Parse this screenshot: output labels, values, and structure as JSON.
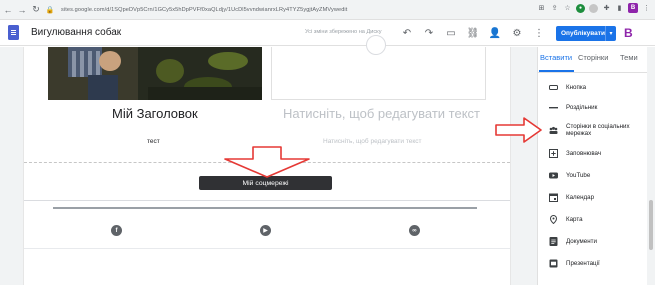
{
  "browser": {
    "url": "sites.google.com/d/1SQpeDVp5Crn/1GCy5x5hDpPVFf0xaQLdjy/1UcDl5vvndwianrxLRy4TYZ5ygjtAyZMVywedit"
  },
  "header": {
    "title": "Вигулювання собак",
    "saved_status": "Усі зміни збережено на Диску",
    "publish_label": "Опублікувати",
    "account_initial": "B"
  },
  "page": {
    "heading": "Мій Заголовок",
    "placeholder_heading": "Натисніть, щоб редагувати текст",
    "caption": "тест",
    "placeholder_caption": "Натисніть, щоб редагувати текст",
    "tooltip": "Мій соцмережі"
  },
  "sidebar": {
    "tabs": [
      {
        "label": "Вставити",
        "active": true
      },
      {
        "label": "Сторінки",
        "active": false
      },
      {
        "label": "Теми",
        "active": false
      }
    ],
    "items": [
      {
        "label": "Кнопка",
        "icon": "button-icon"
      },
      {
        "label": "Роздільник",
        "icon": "divider-icon"
      },
      {
        "label": "Сторінки в соціальних мережах",
        "icon": "social-links-icon"
      },
      {
        "label": "Заповнювач",
        "icon": "placeholder-icon"
      },
      {
        "label": "YouTube",
        "icon": "youtube-icon"
      },
      {
        "label": "Календар",
        "icon": "calendar-icon"
      },
      {
        "label": "Карта",
        "icon": "map-pin-icon"
      },
      {
        "label": "Документи",
        "icon": "docs-icon"
      },
      {
        "label": "Презентації",
        "icon": "slides-icon"
      }
    ]
  },
  "colors": {
    "accent": "#1a73e8",
    "arrow": "#e53935",
    "brand": "#8e24aa"
  }
}
